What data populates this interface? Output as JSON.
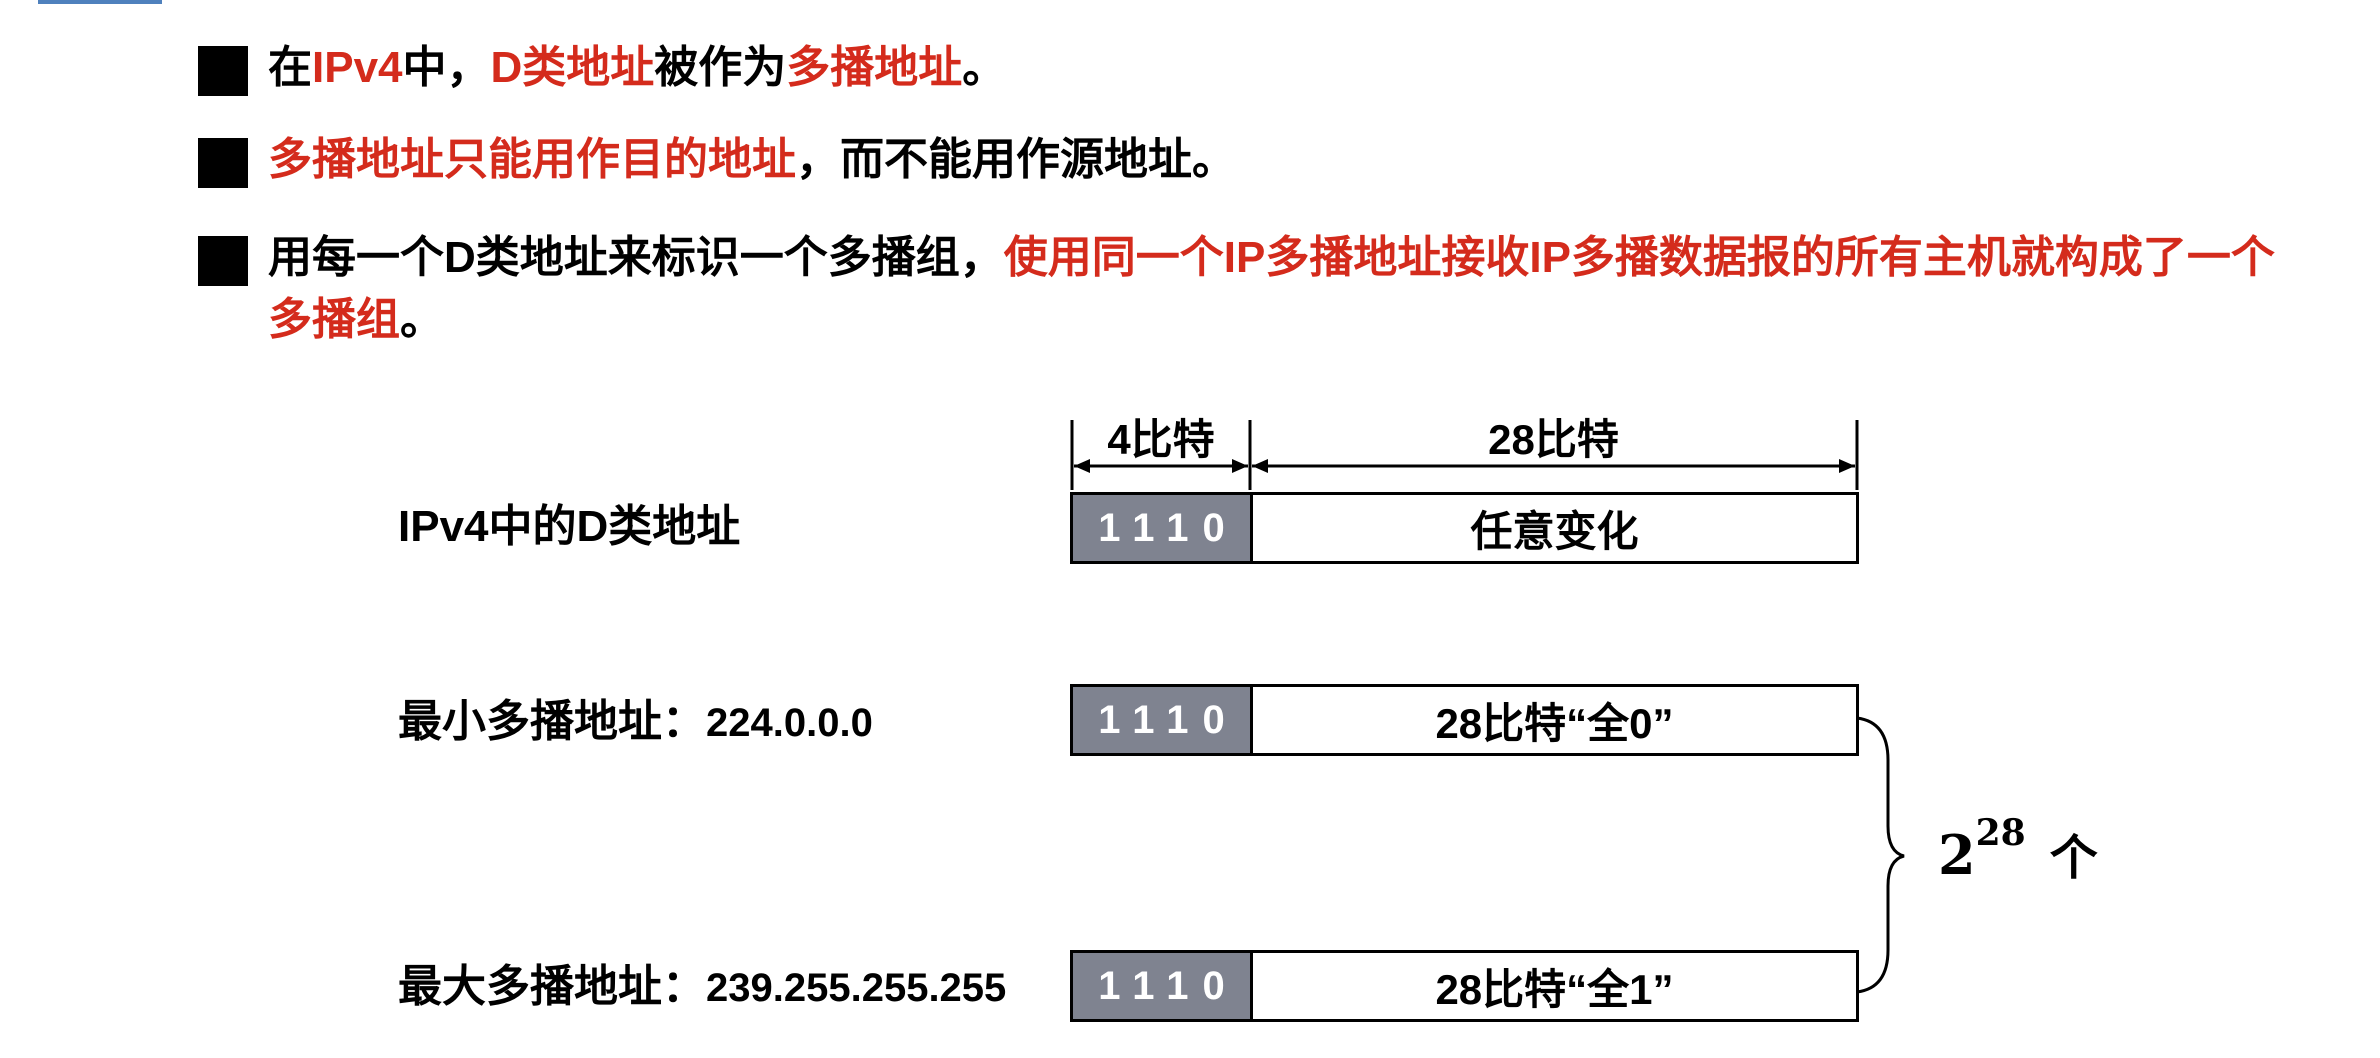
{
  "bullets": {
    "b1": {
      "p1": "在",
      "p2": "IPv4",
      "p3": "中，",
      "p4": "D类地址",
      "p5": "被作为",
      "p6": "多播地址",
      "p7": "。"
    },
    "b2": {
      "p1": "多播地址只能用作目的地址",
      "p2": "，而不能用作源地址。"
    },
    "b3": {
      "p1": "用每一个D类地址来标识一个多播组，",
      "p2": "使用同一个IP多播地址接收IP多播数据报的所有主机就构成了一个",
      "p3": "多播组",
      "p4": "。"
    }
  },
  "diagram": {
    "header_left": "4比特",
    "header_right": "28比特",
    "rows": [
      {
        "label": "IPv4中的D类地址",
        "prefix": "1110",
        "field": "任意变化"
      },
      {
        "label": "最小多播地址：",
        "ip": "224.0.0.0",
        "prefix": "1110",
        "field": "28比特“全0”"
      },
      {
        "label": "最大多播地址：",
        "ip": "239.255.255.255",
        "prefix": "1110",
        "field": "28比特“全1”"
      }
    ],
    "count": {
      "base": "2",
      "exp": "28",
      "unit": "个"
    }
  }
}
